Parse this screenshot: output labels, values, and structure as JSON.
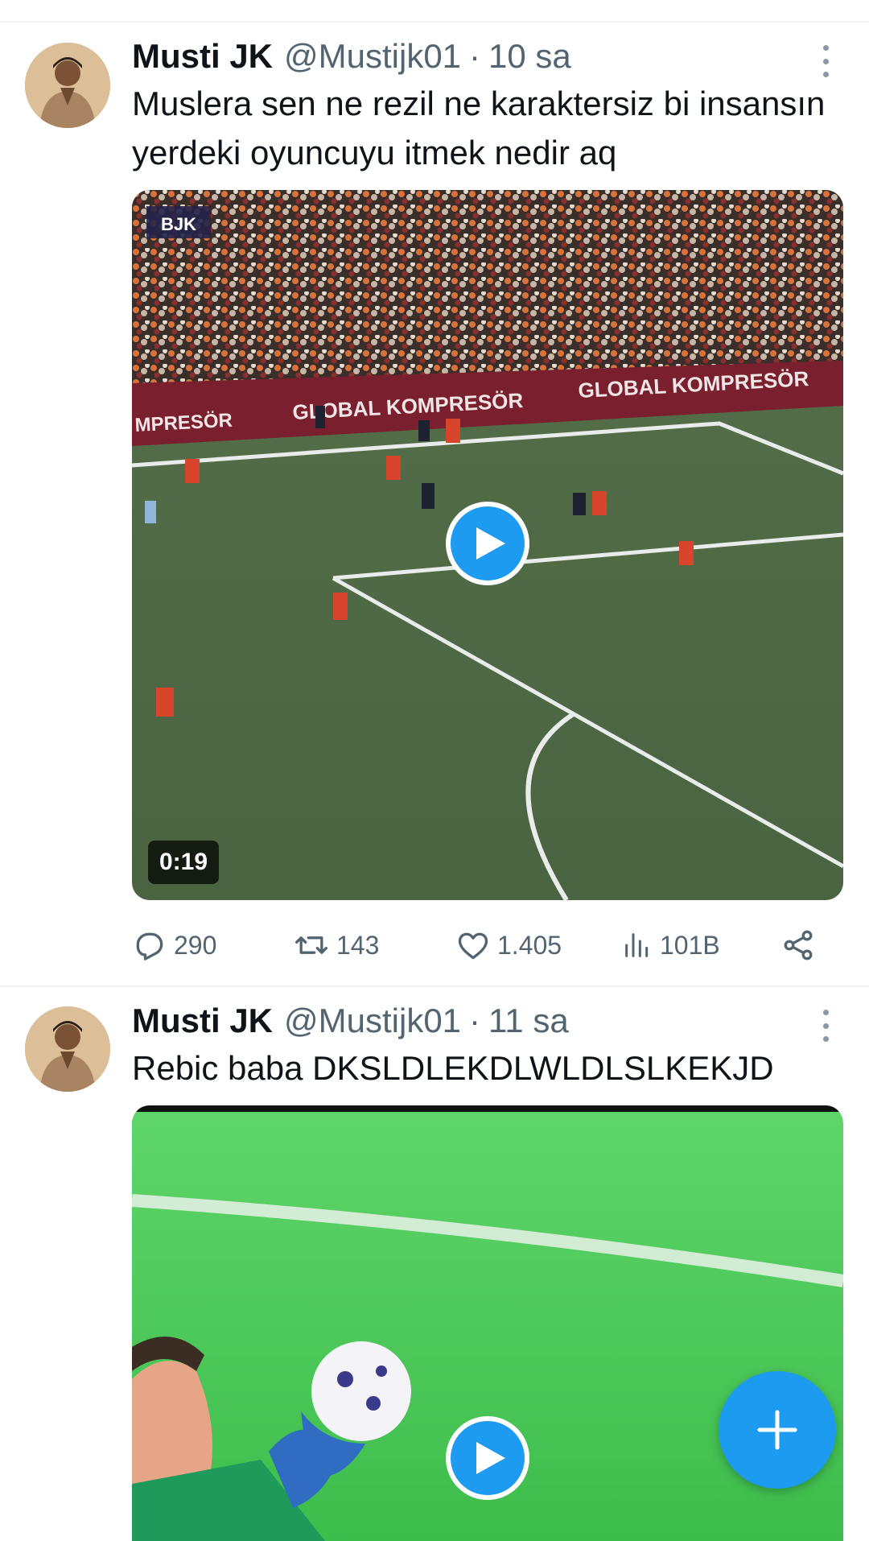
{
  "tweets": [
    {
      "name": "Musti JK",
      "handle": "@Mustijk01",
      "separator": "·",
      "time": "10 sa",
      "text": "Muslera sen ne rezil ne karaktersiz bi insansın yerdeki oyuncuyu itmek nedir aq",
      "video": {
        "duration": "0:19",
        "channel_badge": "BJK",
        "board_text_left": "MPRESÖR",
        "board_text_mid": "GLOBAL KOMPRESÖR",
        "board_text_right": "GLOBAL KOMPRESÖR"
      },
      "stats": {
        "replies": "290",
        "retweets": "143",
        "likes": "1.405",
        "views": "101B"
      }
    },
    {
      "name": "Musti JK",
      "handle": "@Mustijk01",
      "separator": "·",
      "time": "11 sa",
      "text": "Rebic baba  DKSLDLEKDLWLDLSLKEKJD"
    }
  ],
  "compose_button": {
    "icon": "plus-icon"
  },
  "colors": {
    "accent": "#1d9bf0",
    "secondary_text": "#536471",
    "primary_text": "#0f1419"
  }
}
